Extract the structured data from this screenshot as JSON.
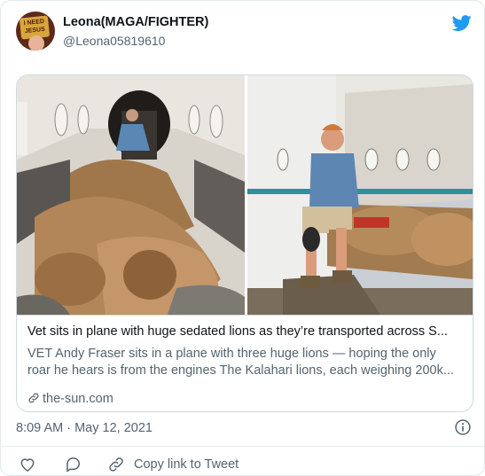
{
  "author": {
    "display_name": "Leona(MAGA/FIGHTER)",
    "handle": "@Leona05819610",
    "avatar_text": "I NEED JESUS"
  },
  "brand": {
    "icon": "twitter-bird-icon",
    "color": "#1d9bf0"
  },
  "card": {
    "title": "Vet sits in plane with huge sedated lions as they’re transported across S...",
    "description_lines": [
      "VET Andy Fraser sits in a plane with three huge lions — hoping the only",
      "roar he hears is from the engines The Kalahari lions, each weighing 200k..."
    ],
    "domain": "the-sun.com"
  },
  "timestamp": "8:09 AM · May 12, 2021",
  "actions": {
    "like_icon": "heart-icon",
    "reply_icon": "reply-icon",
    "copy_link_label": "Copy link to Tweet"
  },
  "colors": {
    "text_secondary": "#536471",
    "border": "#cfd9de"
  }
}
